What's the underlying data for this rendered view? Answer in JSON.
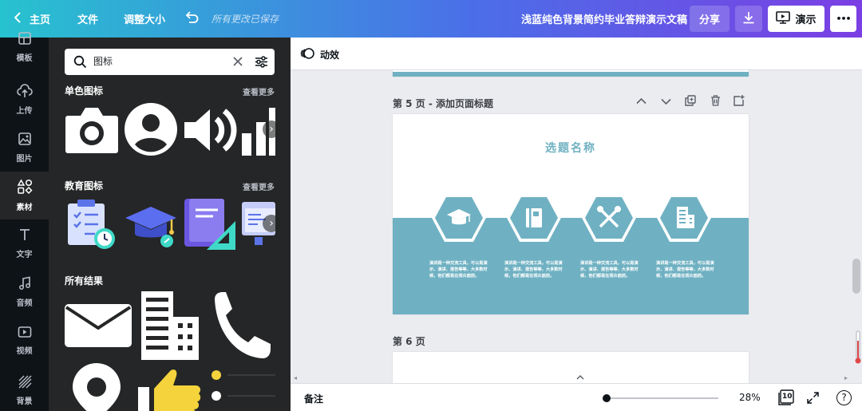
{
  "topbar": {
    "home_label": "主页",
    "file_label": "文件",
    "resize_label": "调整大小",
    "autosave_text": "所有更改已保存",
    "doc_title": "浅蓝纯色背景简约毕业答辩演示文稿",
    "share_label": "分享",
    "present_label": "演示",
    "more_label": "•••"
  },
  "rail": {
    "items": [
      {
        "label": "模板",
        "icon": "template-icon"
      },
      {
        "label": "上传",
        "icon": "upload-icon"
      },
      {
        "label": "图片",
        "icon": "image-icon"
      },
      {
        "label": "素材",
        "icon": "elements-icon"
      },
      {
        "label": "文字",
        "icon": "text-icon"
      },
      {
        "label": "音频",
        "icon": "music-icon"
      },
      {
        "label": "视频",
        "icon": "video-icon"
      },
      {
        "label": "背景",
        "icon": "background-icon"
      }
    ]
  },
  "panel": {
    "search_value": "图标",
    "sections": [
      {
        "title": "单色图标",
        "see_more": "查看更多"
      },
      {
        "title": "教育图标",
        "see_more": "查看更多"
      },
      {
        "title": "所有结果"
      }
    ]
  },
  "toolbar2": {
    "animate_label": "动效"
  },
  "canvas": {
    "page5_label": "第 5 页 - 添加页面标题",
    "page6_label": "第 6 页",
    "slide_title": "选题名称",
    "slide_color": "#6fb1c2",
    "desc_text": "演讲是一种交流工具，可以是演示、演讲、报告等等，大多数时候，他们都是在观众面前。",
    "hex_icons": [
      "graduation-cap-icon",
      "book-icon",
      "tools-icon",
      "building-icon"
    ]
  },
  "bottombar": {
    "notes_label": "备注",
    "zoom_value": "28%",
    "page_count": "10",
    "help_label": "?"
  }
}
